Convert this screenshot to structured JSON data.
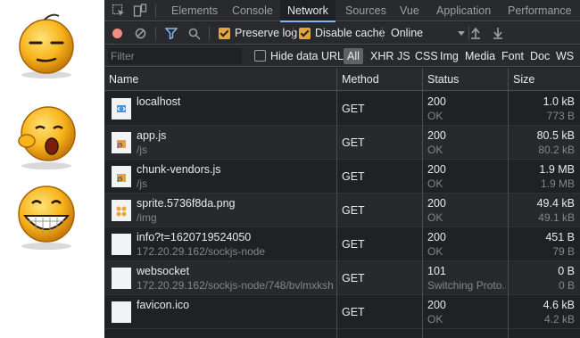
{
  "tabs": {
    "items": [
      "Elements",
      "Console",
      "Network",
      "Sources",
      "Vue",
      "Application",
      "Performance"
    ],
    "active": "Network"
  },
  "toolbar": {
    "preserve_log": "Preserve log",
    "disable_cache": "Disable cache",
    "throttling": "Online"
  },
  "filter": {
    "placeholder": "Filter",
    "hide_data_urls": "Hide data URLs",
    "types": [
      "All",
      "XHR",
      "JS",
      "CSS",
      "Img",
      "Media",
      "Font",
      "Doc",
      "WS"
    ]
  },
  "columns": {
    "name": "Name",
    "method": "Method",
    "status": "Status",
    "size": "Size"
  },
  "rows": [
    {
      "name": "localhost",
      "path": "",
      "method": "GET",
      "status": "200",
      "status_text": "OK",
      "size": "1.0 kB",
      "resource": "773 B",
      "icon": "html-file-icon"
    },
    {
      "name": "app.js",
      "path": "/js",
      "method": "GET",
      "status": "200",
      "status_text": "OK",
      "size": "80.5 kB",
      "resource": "80.2 kB",
      "icon": "js-file-icon"
    },
    {
      "name": "chunk-vendors.js",
      "path": "/js",
      "method": "GET",
      "status": "200",
      "status_text": "OK",
      "size": "1.9 MB",
      "resource": "1.9 MB",
      "icon": "js-file-icon"
    },
    {
      "name": "sprite.5736f8da.png",
      "path": "/img",
      "method": "GET",
      "status": "200",
      "status_text": "OK",
      "size": "49.4 kB",
      "resource": "49.1 kB",
      "icon": "image-file-icon"
    },
    {
      "name": "info?t=1620719524050",
      "path": "172.20.29.162/sockjs-node",
      "method": "GET",
      "status": "200",
      "status_text": "OK",
      "size": "451 B",
      "resource": "79 B",
      "icon": "blank-file-icon"
    },
    {
      "name": "websocket",
      "path": "172.20.29.162/sockjs-node/748/bvlmxksh",
      "method": "GET",
      "status": "101",
      "status_text": "Switching Proto...",
      "size": "0 B",
      "resource": "0 B",
      "icon": "blank-file-icon"
    },
    {
      "name": "favicon.ico",
      "path": "",
      "method": "GET",
      "status": "200",
      "status_text": "OK",
      "size": "4.6 kB",
      "resource": "4.2 kB",
      "icon": "blank-file-icon"
    }
  ],
  "colors": {
    "accent": "#8ab4f8",
    "checkbox": "#e8a33d",
    "record": "#f28b82",
    "background": "#202124"
  }
}
